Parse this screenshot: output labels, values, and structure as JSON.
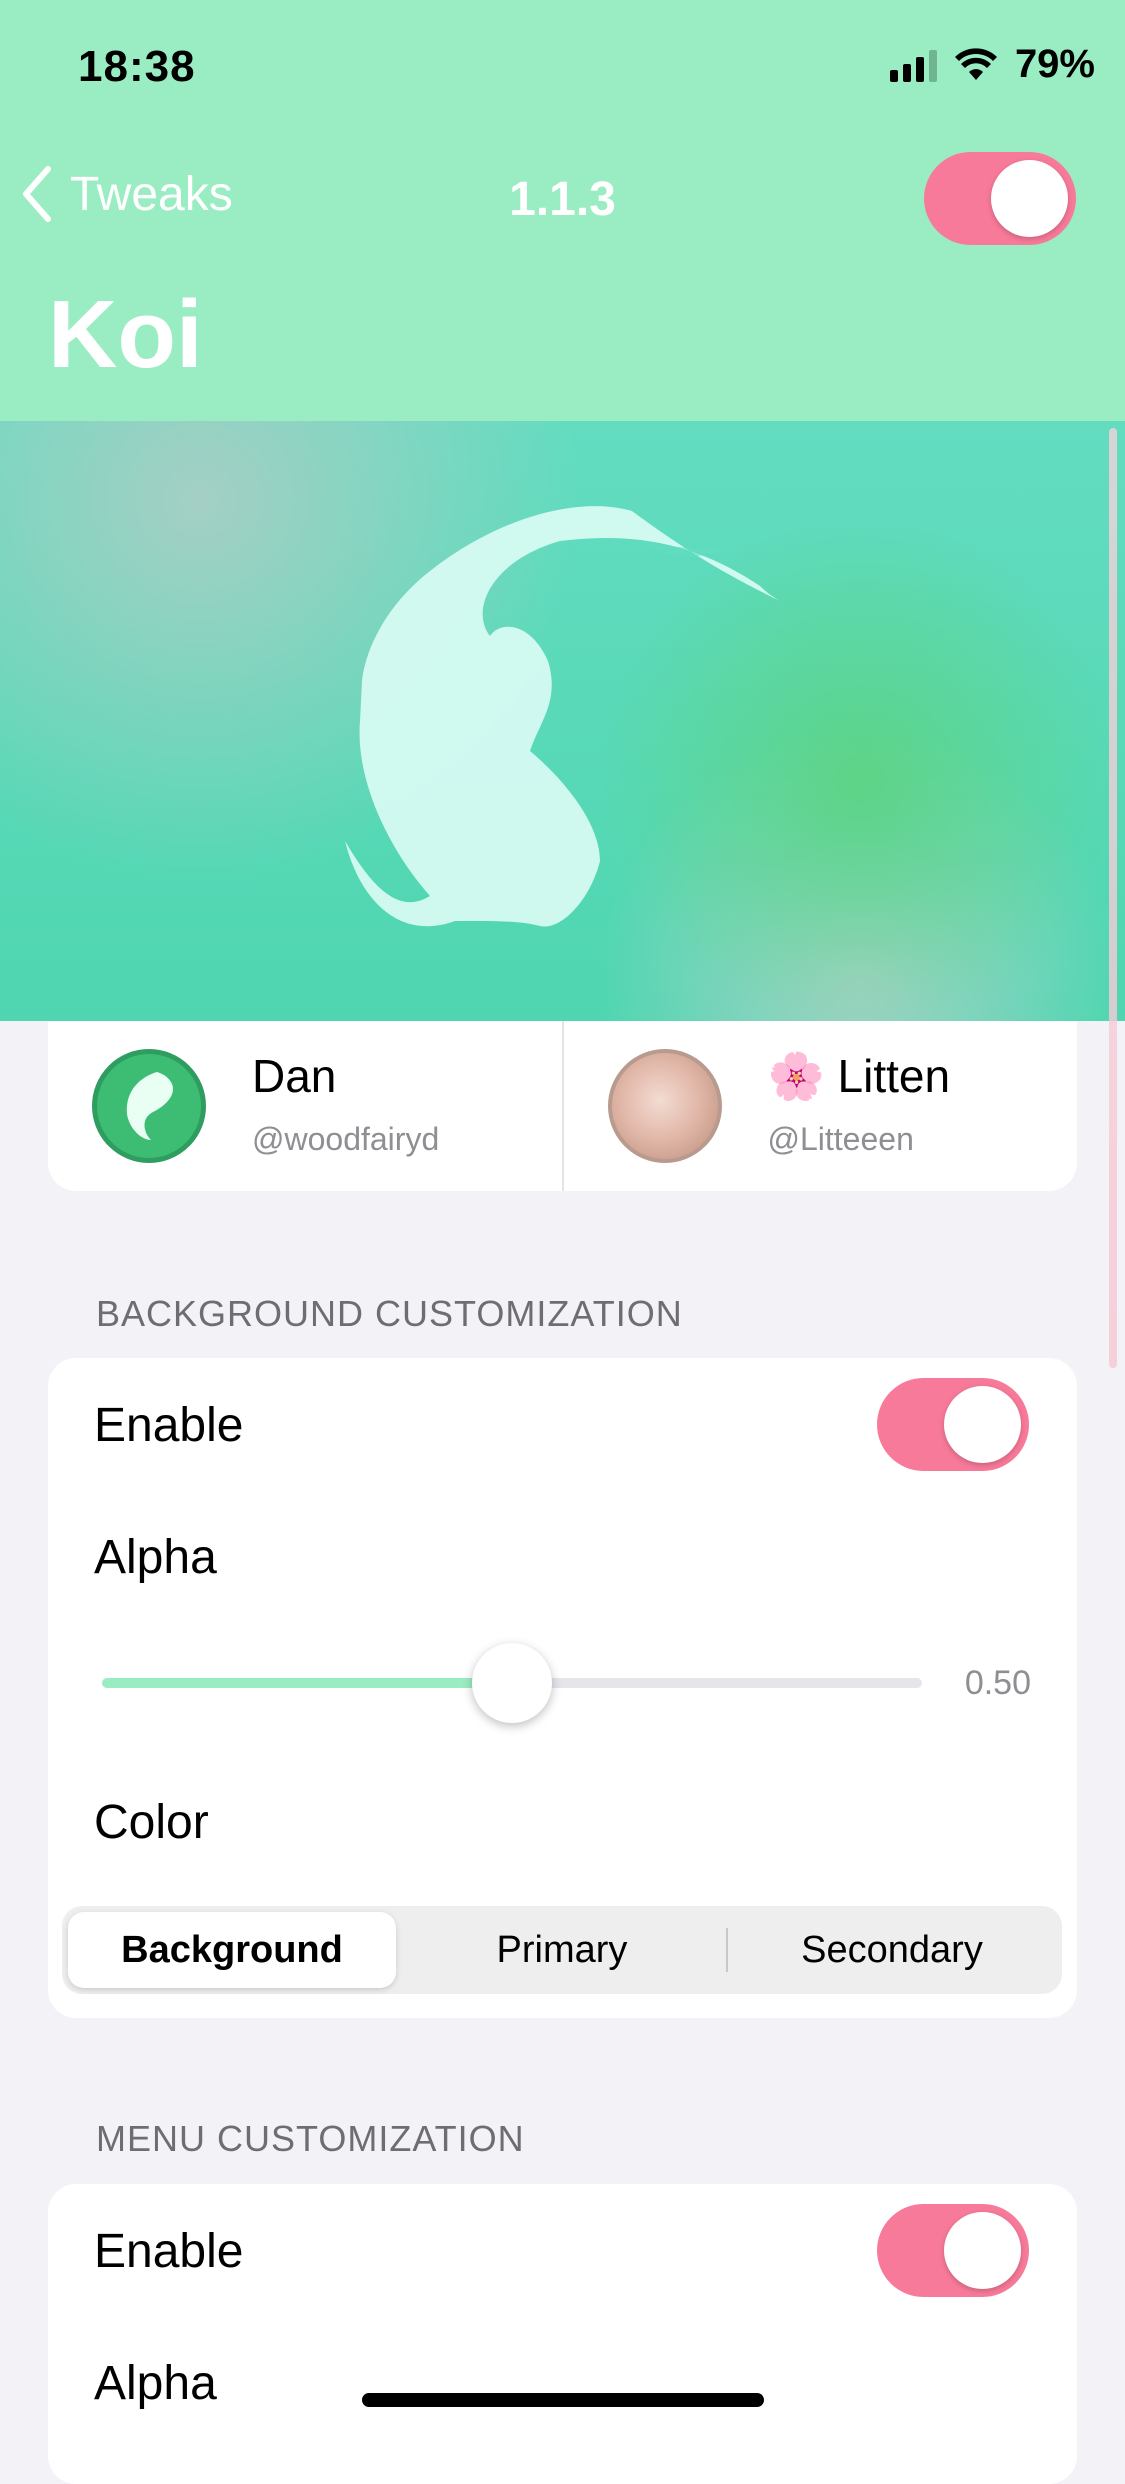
{
  "status_bar": {
    "time": "18:38",
    "battery": "79%"
  },
  "nav": {
    "back_label": "Tweaks",
    "version": "1.1.3",
    "title": "Koi",
    "master_toggle_on": true
  },
  "authors": [
    {
      "name": "Dan",
      "handle": "@woodfairyd"
    },
    {
      "name": "🌸 Litten",
      "handle": "@Litteeen"
    }
  ],
  "background_customization": {
    "header": "BACKGROUND CUSTOMIZATION",
    "enable_label": "Enable",
    "enable_on": true,
    "alpha_label": "Alpha",
    "alpha_value": "0.50",
    "alpha_fraction": 0.5,
    "color_label": "Color",
    "color_options": [
      "Background",
      "Primary",
      "Secondary"
    ],
    "color_selected": "Background"
  },
  "menu_customization": {
    "header": "MENU CUSTOMIZATION",
    "enable_label": "Enable",
    "enable_on": true,
    "alpha_label": "Alpha"
  },
  "colors": {
    "accent_green": "#9aedc2",
    "toggle_pink": "#f87a9a"
  }
}
